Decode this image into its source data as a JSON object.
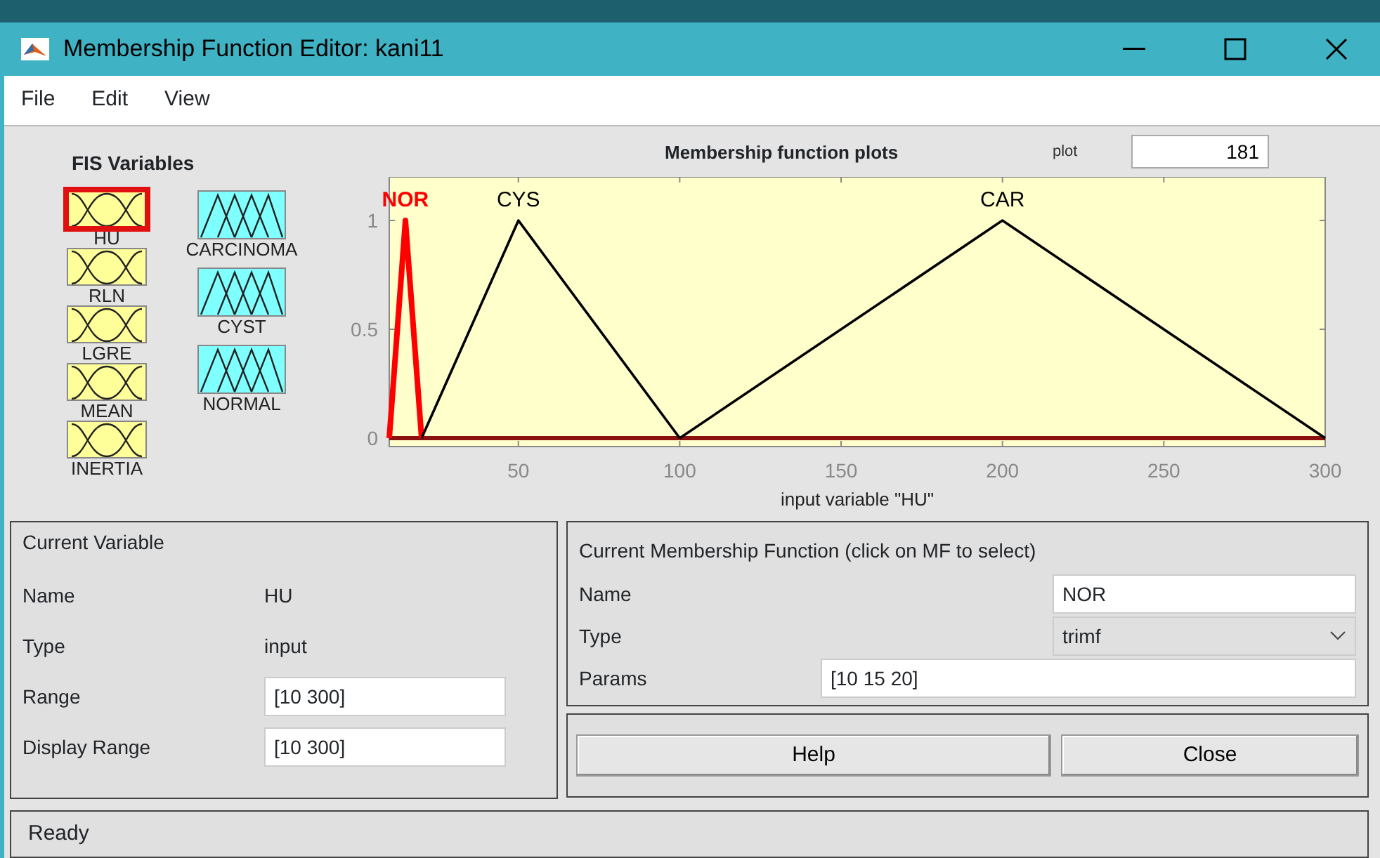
{
  "window": {
    "title": "Membership Function Editor: kani11"
  },
  "menu": [
    "File",
    "Edit",
    "View"
  ],
  "fis_variables": {
    "title": "FIS Variables",
    "items": [
      {
        "name": "HU",
        "kind": "input",
        "selected": true
      },
      {
        "name": "RLN",
        "kind": "input",
        "selected": false
      },
      {
        "name": "LGRE",
        "kind": "input",
        "selected": false
      },
      {
        "name": "MEAN",
        "kind": "input",
        "selected": false
      },
      {
        "name": "INERTIA",
        "kind": "input",
        "selected": false
      },
      {
        "name": "CARCINOMA",
        "kind": "output",
        "selected": false
      },
      {
        "name": "CYST",
        "kind": "output",
        "selected": false
      },
      {
        "name": "NORMAL",
        "kind": "output",
        "selected": false
      }
    ]
  },
  "plot": {
    "title": "Membership function plots",
    "points_label": "plot",
    "points": "181",
    "chart_data": {
      "type": "line",
      "xlabel": "input variable \"HU\"",
      "x": [
        10,
        15,
        20,
        50,
        100,
        200,
        300
      ],
      "series": [
        {
          "name": "NOR",
          "color": "#ff0000",
          "values": [
            0,
            1,
            0,
            null,
            null,
            null,
            null
          ]
        },
        {
          "name": "CYS",
          "color": "#000000",
          "values": [
            null,
            null,
            0,
            1,
            0,
            null,
            null
          ]
        },
        {
          "name": "CAR",
          "color": "#000000",
          "values": [
            null,
            null,
            null,
            null,
            0,
            1,
            0
          ]
        }
      ],
      "xlim": [
        10,
        300
      ],
      "ylim": [
        0,
        1.2
      ],
      "xticks": [
        50,
        100,
        150,
        200,
        250,
        300
      ],
      "yticks": [
        0,
        0.5,
        1
      ]
    }
  },
  "current_variable": {
    "title": "Current Variable",
    "rows": [
      {
        "label": "Name",
        "value": "HU",
        "kind": "text"
      },
      {
        "label": "Type",
        "value": "input",
        "kind": "text"
      },
      {
        "label": "Range",
        "value": "[10 300]",
        "kind": "field"
      },
      {
        "label": "Display Range",
        "value": "[10 300]",
        "kind": "field"
      }
    ]
  },
  "current_mf": {
    "title": "Current Membership Function (click on MF to select)",
    "rows": [
      {
        "label": "Name",
        "value": "NOR",
        "kind": "field"
      },
      {
        "label": "Type",
        "value": "trimf",
        "kind": "dropdown"
      },
      {
        "label": "Params",
        "value": "[10 15 20]",
        "kind": "wide-field"
      }
    ]
  },
  "buttons": [
    "Help",
    "Close"
  ],
  "status": "Ready"
}
